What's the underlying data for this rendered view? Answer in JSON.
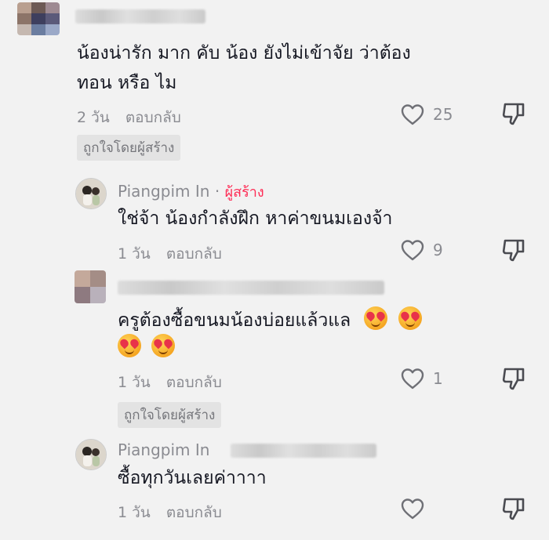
{
  "comments": [
    {
      "text_line1": "น้องน่ารัก มาก คับ น้อง ยังไม่เข้าจัย ว่าต้อง",
      "text_line2": "ทอน หรือ ไม",
      "time": "2 วัน",
      "reply_label": "ตอบกลับ",
      "likes": "25",
      "creator_liked": "ถูกใจโดยผู้สร้าง"
    },
    {
      "username": "Piangpim In",
      "separator": "·",
      "creator_label": "ผู้สร้าง",
      "text": "ใช่จ้า น้องกำลังฝึก หาค่าขนมเองจ้า",
      "time": "1 วัน",
      "reply_label": "ตอบกลับ",
      "likes": "9"
    },
    {
      "text_line1": "ครูต้องซื้อขนมน้องบ่อยแล้วแล",
      "time": "1 วัน",
      "reply_label": "ตอบกลับ",
      "likes": "1",
      "creator_liked": "ถูกใจโดยผู้สร้าง"
    },
    {
      "username": "Piangpim In",
      "text": "ซื้อทุกวันเลยค่าาาา",
      "time": "1 วัน",
      "reply_label": "ตอบกลับ",
      "likes": ""
    }
  ],
  "icons": {
    "like": "heart-outline-icon",
    "dislike": "thumbs-down-icon",
    "emoji": "smiling-face-with-hearts-icon"
  },
  "colors": {
    "background": "#f2f2f2",
    "text": "#161823",
    "muted": "#8a8b91",
    "creator": "#fe2c55"
  }
}
